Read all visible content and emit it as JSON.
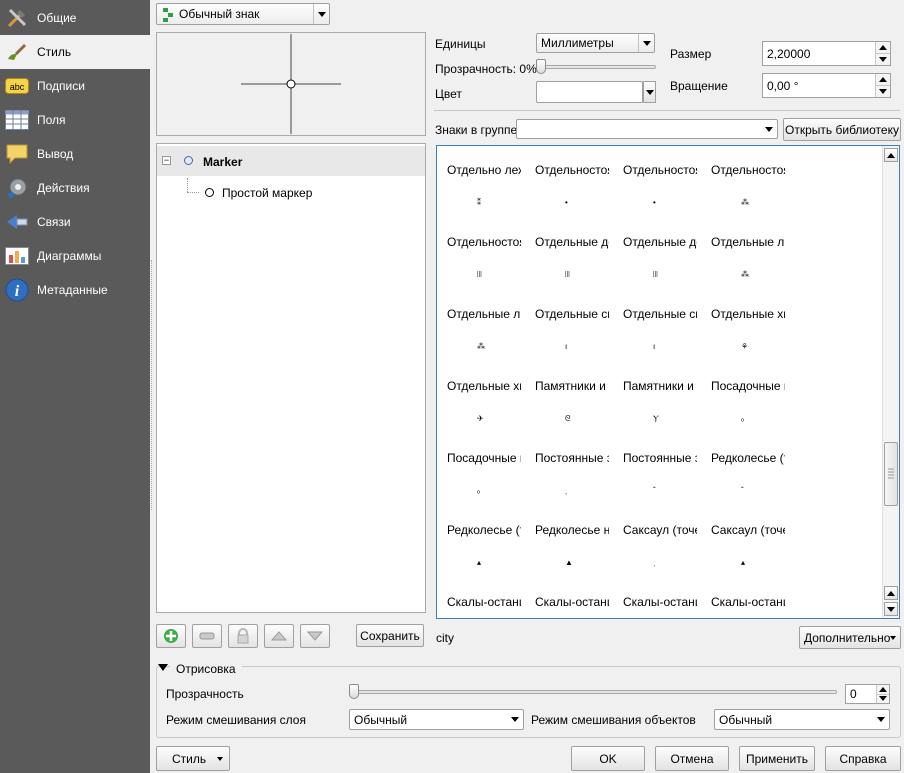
{
  "sidebar": {
    "items": [
      {
        "label": "Общие",
        "icon": "tools-icon"
      },
      {
        "label": "Стиль",
        "icon": "paintbrush-icon"
      },
      {
        "label": "Подписи",
        "icon": "abc-labels-icon"
      },
      {
        "label": "Поля",
        "icon": "table-fields-icon"
      },
      {
        "label": "Вывод",
        "icon": "speech-bubble-icon"
      },
      {
        "label": "Действия",
        "icon": "gear-actions-icon"
      },
      {
        "label": "Связи",
        "icon": "joins-icon"
      },
      {
        "label": "Диаграммы",
        "icon": "chart-icon"
      },
      {
        "label": "Метаданные",
        "icon": "info-icon"
      }
    ],
    "active_index": 1
  },
  "renderer": {
    "selected": "Обычный знак"
  },
  "tree": {
    "root": "Marker",
    "child": "Простой маркер"
  },
  "properties": {
    "units_label": "Единицы",
    "units_value": "Миллиметры",
    "transparency_label": "Прозрачность: 0%",
    "transparency_value": 0,
    "color_label": "Цвет",
    "color_value": "#ffffff",
    "size_label": "Размер",
    "size_value": "2,20000",
    "rotation_label": "Вращение",
    "rotation_value": "0,00 °"
  },
  "library": {
    "group_label": "Знаки в группе",
    "group_value": "",
    "open_library_label": "Открыть библиотеку"
  },
  "symbols": [
    {
      "name": "Отдельно лежащие",
      "glyph": "⁑"
    },
    {
      "name": "Отдельностоящие",
      "glyph": "•"
    },
    {
      "name": "Отдельностоящие",
      "glyph": "•"
    },
    {
      "name": "Отдельностоящие",
      "glyph": "⁂"
    },
    {
      "name": "Отдельностоящие",
      "glyph": "ꔖ"
    },
    {
      "name": "Отдельные деревья",
      "glyph": "ꔖ"
    },
    {
      "name": "Отдельные деревья",
      "glyph": "ꔖ"
    },
    {
      "name": "Отдельные лиственные",
      "glyph": "⁂"
    },
    {
      "name": "Отдельные лиственные",
      "glyph": "⁂"
    },
    {
      "name": "Отдельные смешанные",
      "glyph": "ı"
    },
    {
      "name": "Отдельные смешанные",
      "glyph": "ı"
    },
    {
      "name": "Отдельные хвойные",
      "glyph": "⚘"
    },
    {
      "name": "Отдельные хвойные",
      "glyph": "✈"
    },
    {
      "name": "Памятники и монументы",
      "glyph": "ᘓ"
    },
    {
      "name": "Памятники и монументы",
      "glyph": "Ⲩ"
    },
    {
      "name": "Посадочные площадки",
      "glyph": "ₒ"
    },
    {
      "name": "Посадочные площадки",
      "glyph": "ₒ"
    },
    {
      "name": "Постоянные знаки",
      "glyph": "ˎ"
    },
    {
      "name": "Постоянные знаки",
      "glyph": "ˆ"
    },
    {
      "name": "Редколесье (точечное)",
      "glyph": "ˆ"
    },
    {
      "name": "Редколесье (точечное)",
      "glyph": "▴"
    },
    {
      "name": "Редколесье низкорослое",
      "glyph": "▲"
    },
    {
      "name": "Саксаул (точечный)",
      "glyph": "ˌ"
    },
    {
      "name": "Саксаул (точечный)",
      "glyph": "▴"
    },
    {
      "name": "Скалы-останцы",
      "glyph": ""
    },
    {
      "name": "Скалы-останцы",
      "glyph": ""
    },
    {
      "name": "Скалы-останцы",
      "glyph": ""
    },
    {
      "name": "Скалы-останцы",
      "glyph": ""
    }
  ],
  "toolbar": {
    "save_label": "Сохранить"
  },
  "symbol_name": "city",
  "advanced_label": "Дополнительно",
  "rendering": {
    "group_title": "Отрисовка",
    "transparency_label": "Прозрачность",
    "transparency_value": "0",
    "layer_blend_label": "Режим смешивания слоя",
    "layer_blend_value": "Обычный",
    "feature_blend_label": "Режим смешивания объектов",
    "feature_blend_value": "Обычный"
  },
  "footer": {
    "style_label": "Стиль",
    "ok_label": "OK",
    "cancel_label": "Отмена",
    "apply_label": "Применить",
    "help_label": "Справка"
  },
  "colors": {
    "sidebar_bg": "#5a5a5a",
    "selection_blue": "#3c7fb1"
  }
}
